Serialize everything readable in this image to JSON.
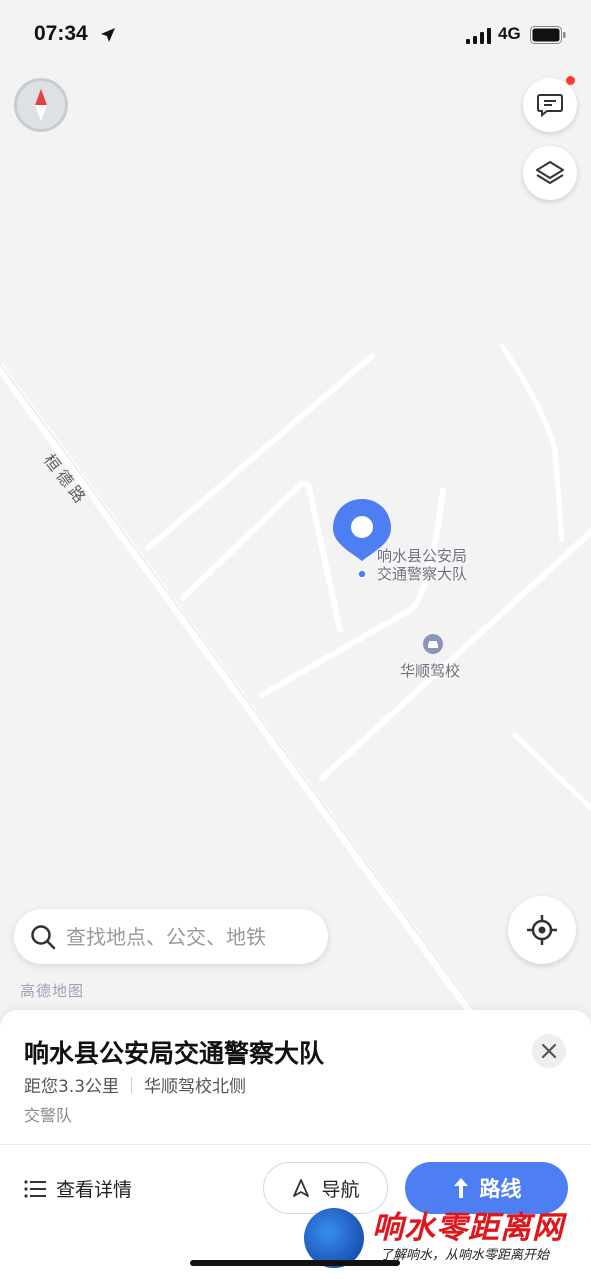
{
  "status_bar": {
    "time": "07:34",
    "network": "4G"
  },
  "map": {
    "road_label": "桓德路",
    "poi_name_line1": "响水县公安局",
    "poi_name_line2": "交通警察大队",
    "nearby_poi": "华顺驾校",
    "brand": "高德地图"
  },
  "search": {
    "placeholder": "查找地点、公交、地铁"
  },
  "place": {
    "title": "响水县公安局交通警察大队",
    "distance": "距您3.3公里",
    "location_hint": "华顺驾校北侧",
    "category": "交警队"
  },
  "actions": {
    "details_label": "查看详情",
    "navigate_label": "导航",
    "route_label": "路线"
  },
  "watermark": {
    "title": "响水零距离网",
    "subtitle": "了解响水，从响水零距离开始"
  },
  "colors": {
    "accent": "#4e7ff2",
    "poi_pin": "#4e7ff2",
    "notification": "#ff3b30"
  }
}
